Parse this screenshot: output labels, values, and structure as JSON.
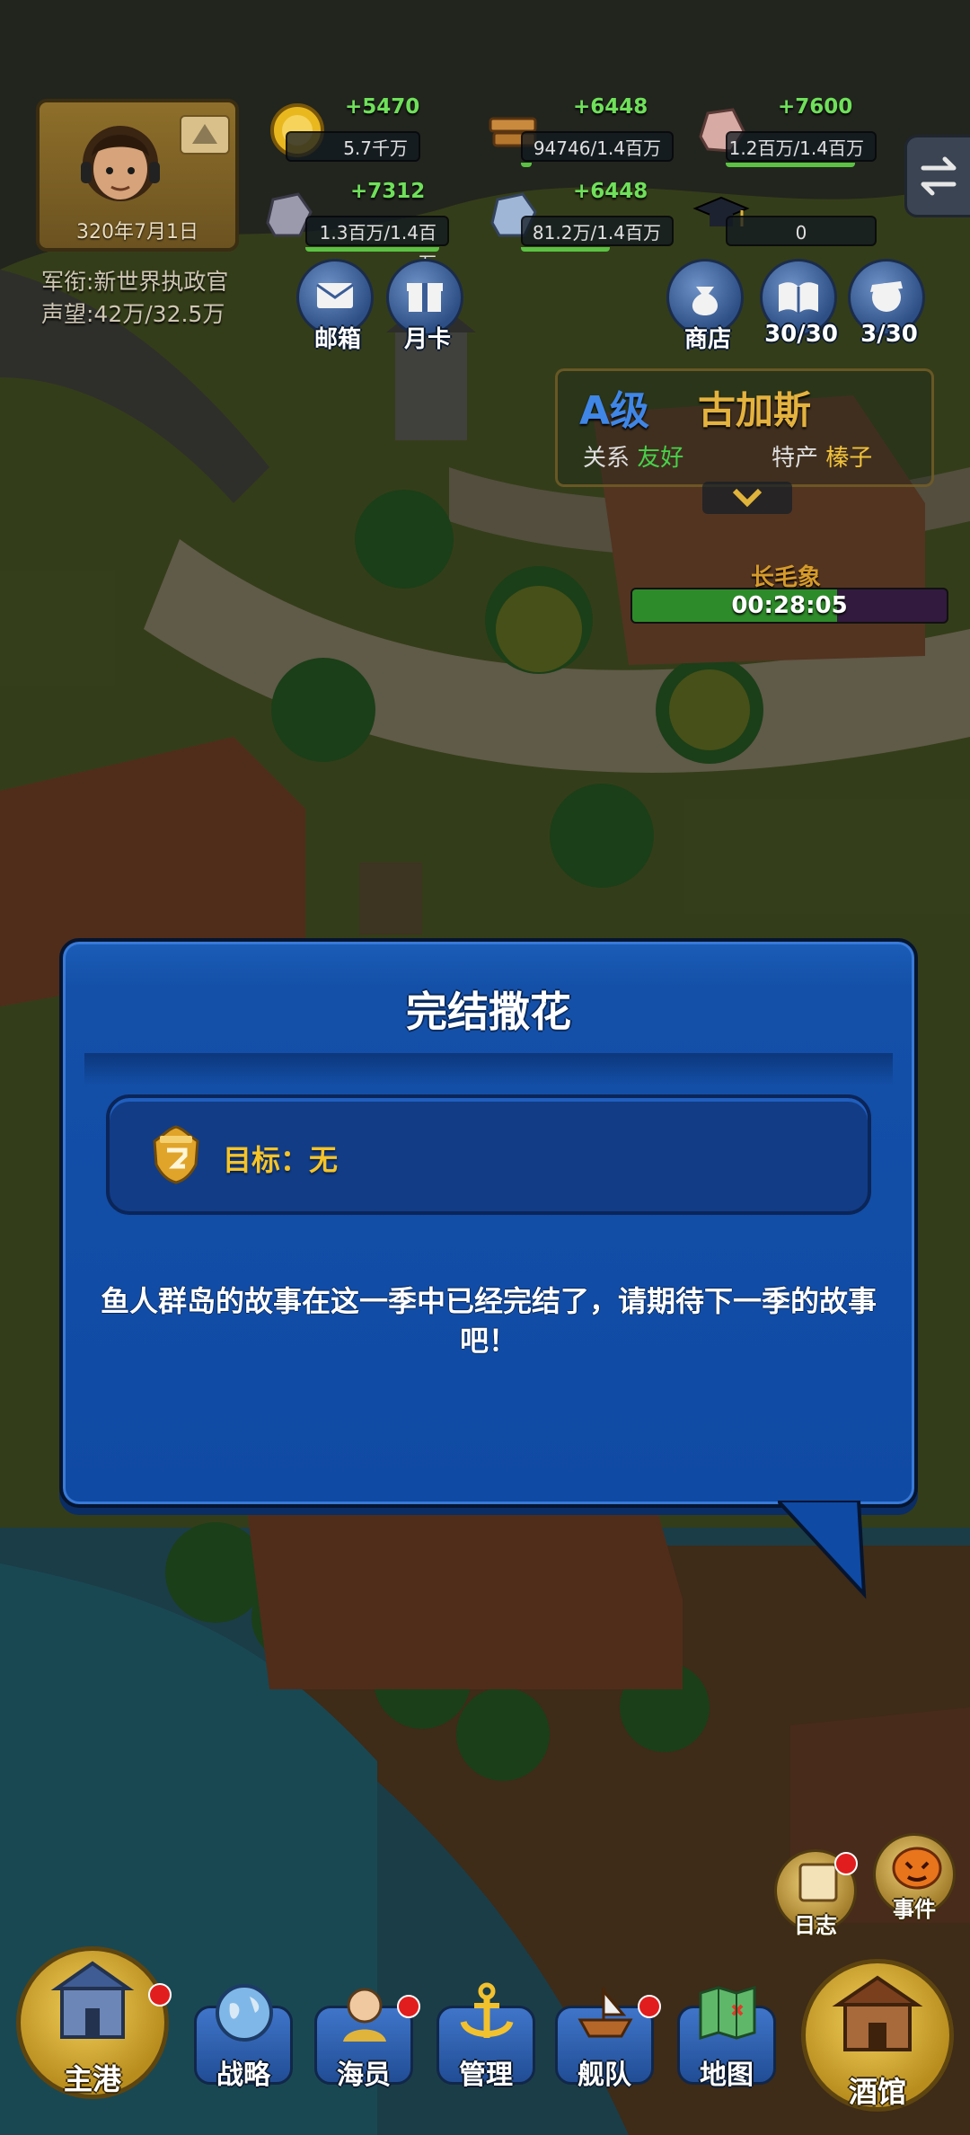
{
  "player": {
    "date": "320年7月1日",
    "rank_line": "军衔:新世界执政官",
    "reputation_line": "声望:42万/32.5万"
  },
  "resources": [
    {
      "id": "gold",
      "icon": "gold-coin-icon",
      "gain": "+5470",
      "amount": "5.7千万",
      "fill": 0.0
    },
    {
      "id": "wood",
      "icon": "wood-planks-icon",
      "gain": "+6448",
      "amount": "94746/1.4百万",
      "fill": 0.07
    },
    {
      "id": "stone",
      "icon": "stone-icon",
      "gain": "+7600",
      "amount": "1.2百万/1.4百万",
      "fill": 0.86
    },
    {
      "id": "iron",
      "icon": "iron-ore-icon",
      "gain": "+7312",
      "amount": "1.3百万/1.4百万",
      "fill": 0.93
    },
    {
      "id": "crystal",
      "icon": "crystal-ore-icon",
      "gain": "+6448",
      "amount": "81.2万/1.4百万",
      "fill": 0.58
    },
    {
      "id": "scholar",
      "icon": "graduation-cap-icon",
      "gain": "",
      "amount": "0",
      "fill": 0.0
    }
  ],
  "top_buttons": {
    "mail": "邮箱",
    "monthly_card": "月卡",
    "shop": "商店",
    "quests": "30/30",
    "crew": "3/30"
  },
  "city": {
    "grade": "A级",
    "name": "古加斯",
    "relation_label": "关系",
    "relation_value": "友好",
    "specialty_label": "特产",
    "specialty_value": "榛子",
    "building": "长毛象",
    "timer": "00:28:05",
    "timer_progress": 0.65
  },
  "modal": {
    "title": "完结撒花",
    "goal": "目标：无",
    "message": "鱼人群岛的故事在这一季中已经完结了，请期待下一季的故事吧！"
  },
  "side_buttons": {
    "log": "日志",
    "event": "事件"
  },
  "nav": {
    "home_port": "主港",
    "strategy": "战略",
    "sailors": "海员",
    "manage": "管理",
    "fleet": "舰队",
    "map": "地图",
    "tavern": "酒馆"
  },
  "colors": {
    "modal_blue": "#1450a8",
    "goal_yellow": "#f6c427",
    "gain_green": "#6fe05a",
    "grade_blue": "#3f86e6",
    "city_gold": "#e4b23e"
  }
}
